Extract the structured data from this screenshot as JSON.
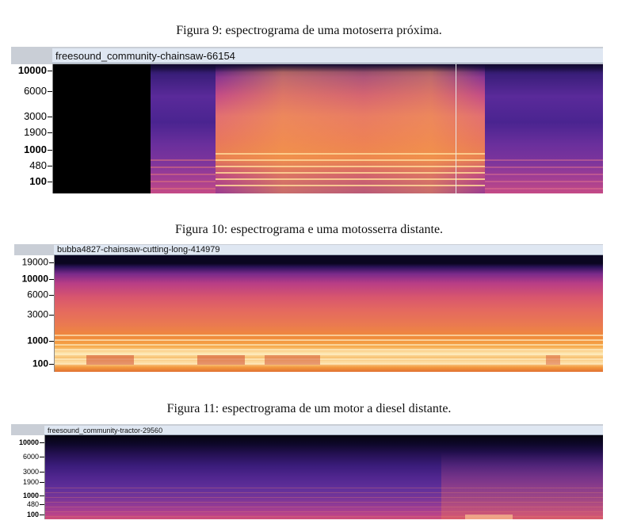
{
  "figures": [
    {
      "caption": "Figura 9: espectrograma de uma motoserra próxima.",
      "track_name": "freesound_community-chainsaw-66154",
      "axis_ticks": [
        {
          "label": "10000",
          "major": true
        },
        {
          "label": "6000",
          "major": false
        },
        {
          "label": "3000",
          "major": false
        },
        {
          "label": "1900",
          "major": false
        },
        {
          "label": "1000",
          "major": true
        },
        {
          "label": "480",
          "major": false
        },
        {
          "label": "100",
          "major": true
        }
      ]
    },
    {
      "caption": "Figura 10: espectrograma e uma motosserra distante.",
      "track_name": "bubba4827-chainsaw-cutting-long-414979",
      "axis_ticks": [
        {
          "label": "19000",
          "major": false
        },
        {
          "label": "10000",
          "major": true
        },
        {
          "label": "6000",
          "major": false
        },
        {
          "label": "3000",
          "major": false
        },
        {
          "label": "1000",
          "major": true
        },
        {
          "label": "100",
          "major": true
        }
      ]
    },
    {
      "caption": "Figura 11: espectrograma de um motor a diesel distante.",
      "track_name": "freesound_community-tractor-29560",
      "axis_ticks": [
        {
          "label": "10000",
          "major": true
        },
        {
          "label": "6000",
          "major": false
        },
        {
          "label": "3000",
          "major": false
        },
        {
          "label": "1900",
          "major": false
        },
        {
          "label": "1000",
          "major": true
        },
        {
          "label": "480",
          "major": false
        },
        {
          "label": "100",
          "major": true
        }
      ]
    }
  ],
  "colors": {
    "spectrogram_dark": "#120a3a",
    "spectrogram_purple": "#5a2a9a",
    "spectrogram_magenta": "#b8388a",
    "spectrogram_orange": "#f08a3a",
    "spectrogram_light": "#fde6b0",
    "track_header_bg": "#dfe7f2"
  }
}
